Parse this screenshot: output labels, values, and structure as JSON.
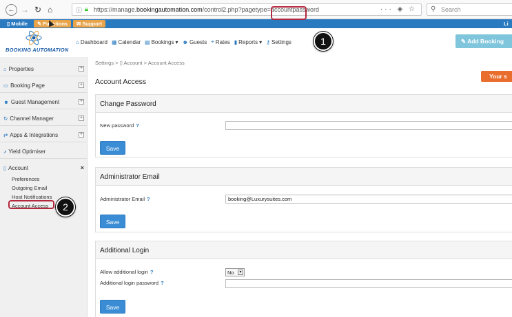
{
  "browser": {
    "url_prefix": "https://manage.",
    "url_domain": "bookingautomation.com",
    "url_path": "/control2.php?pagetype=accountpassword",
    "url_actions": "··· ◈ ☆",
    "search_placeholder": "Search"
  },
  "topbar": {
    "mobile_label": "Mobile",
    "functions_label": "Functions",
    "support_label": "Support",
    "right_label": "Li"
  },
  "header": {
    "logo_text": "BOOKING AUTOMATION",
    "nav": [
      {
        "label": "Dashboard",
        "icon": "dashboard-icon"
      },
      {
        "label": "Calendar",
        "icon": "calendar-icon"
      },
      {
        "label": "Bookings",
        "icon": "bookings-icon",
        "caret": "▾"
      },
      {
        "label": "Guests",
        "icon": "guests-icon"
      },
      {
        "label": "Rates",
        "icon": "rates-icon"
      },
      {
        "label": "Reports",
        "icon": "reports-icon",
        "caret": "▾"
      },
      {
        "label": "Settings",
        "icon": "key-icon"
      }
    ],
    "add_booking_label": "Add Booking"
  },
  "callouts": {
    "one": "1",
    "two": "2"
  },
  "sidebar": {
    "items": [
      {
        "label": "Properties",
        "control": "+"
      },
      {
        "label": "Booking Page",
        "control": "+"
      },
      {
        "label": "Guest Management",
        "control": "+"
      },
      {
        "label": "Channel Manager",
        "control": "+"
      },
      {
        "label": "Apps & Integrations",
        "control": "+"
      },
      {
        "label": "Yield Optimiser",
        "control": ""
      },
      {
        "label": "Account",
        "control": "×"
      }
    ],
    "subitems": [
      "Preferences",
      "Outgoing Email",
      "Host Notifications",
      "Account Access"
    ]
  },
  "main": {
    "breadcrumb": {
      "root": "Settings",
      "sep": ">",
      "level1": "Account",
      "level2": "Account Access"
    },
    "title": "Account Access",
    "orange_button": "Your s",
    "change_password": {
      "title": "Change Password",
      "new_password_label": "New password",
      "new_password_value": "",
      "save_label": "Save"
    },
    "admin_email": {
      "title": "Administrator Email",
      "email_label": "Administrator Email",
      "email_value": "booking@Luxurysuites.com",
      "save_label": "Save"
    },
    "additional_login": {
      "title": "Additional Login",
      "allow_label": "Allow additional login",
      "allow_value": "No",
      "password_label": "Additional login password",
      "password_value": "",
      "save_label": "Save"
    },
    "help_mark": "?"
  },
  "colors": {
    "brand_blue": "#2a7ac0",
    "highlight_red": "#b3283d",
    "orange": "#e96d2c",
    "button_blue": "#3a8dd4"
  }
}
